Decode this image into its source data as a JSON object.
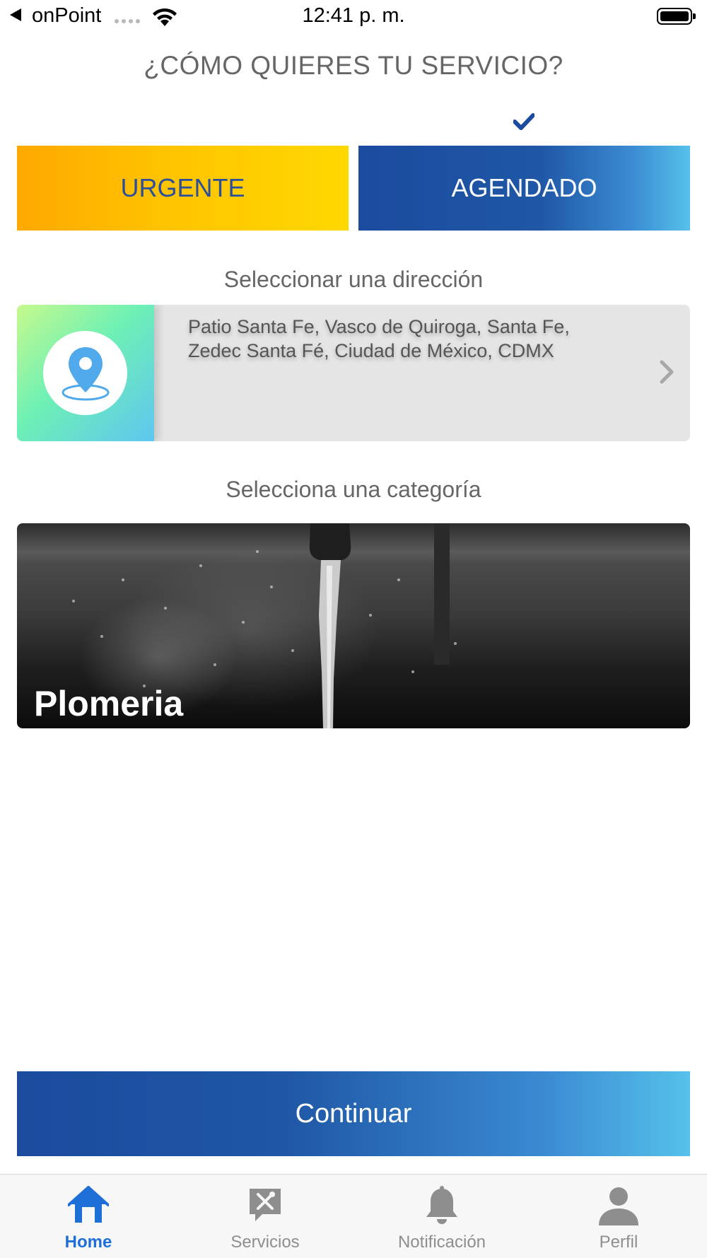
{
  "status_bar": {
    "carrier": "onPoint",
    "time": "12:41 p. m."
  },
  "title": "¿CÓMO QUIERES TU SERVICIO?",
  "mode": {
    "urgent_label": "URGENTE",
    "scheduled_label": "AGENDADO",
    "selected": "AGENDADO"
  },
  "address_section": {
    "label": "Seleccionar una dirección",
    "address": "Patio Santa Fe,  Vasco de Quiroga,  Santa Fe,  Zedec Santa Fé,  Ciudad de México, CDMX"
  },
  "category_section": {
    "label": "Selecciona una categoría",
    "category_name": "Plomeria"
  },
  "continue_label": "Continuar",
  "tabs": [
    {
      "label": "Home",
      "icon": "home-icon",
      "active": true
    },
    {
      "label": "Servicios",
      "icon": "tools-icon",
      "active": false
    },
    {
      "label": "Notificación",
      "icon": "bell-icon",
      "active": false
    },
    {
      "label": "Perfil",
      "icon": "person-icon",
      "active": false
    }
  ],
  "colors": {
    "primary_blue": "#1b4b9e",
    "accent_light_blue": "#56c1ea",
    "urgent_yellow": "#ffc400",
    "active_tab": "#1e6fd8"
  }
}
